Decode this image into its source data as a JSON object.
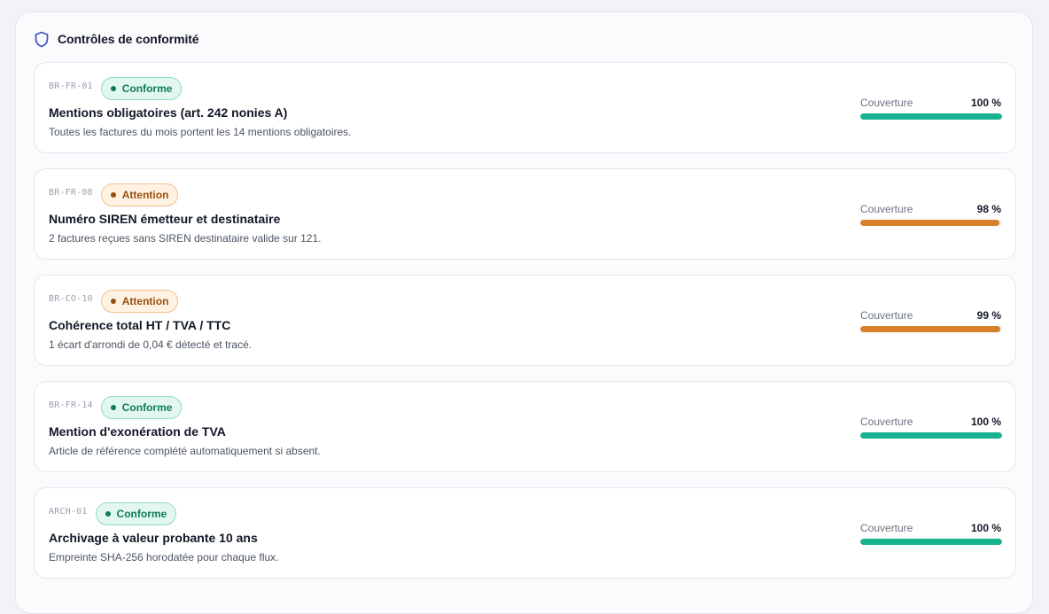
{
  "panel": {
    "title": "Contrôles de conformité",
    "icon": "shield-icon"
  },
  "colors": {
    "accent_ok": "#17b290",
    "accent_warn": "#d77f2b",
    "icon_blue": "#3b4fc8"
  },
  "checks": [
    {
      "code": "BR-FR-01",
      "status": "Conforme",
      "status_type": "ok",
      "title": "Mentions obligatoires (art. 242 nonies A)",
      "description": "Toutes les factures du mois portent les 14 mentions obligatoires.",
      "coverage_label": "Couverture",
      "coverage_text": "100 %",
      "coverage": 100
    },
    {
      "code": "BR-FR-08",
      "status": "Attention",
      "status_type": "warn",
      "title": "Numéro SIREN émetteur et destinataire",
      "description": "2 factures reçues sans SIREN destinataire valide sur 121.",
      "coverage_label": "Couverture",
      "coverage_text": "98 %",
      "coverage": 98
    },
    {
      "code": "BR-CO-10",
      "status": "Attention",
      "status_type": "warn",
      "title": "Cohérence total HT / TVA / TTC",
      "description": "1 écart d'arrondi de 0,04 € détecté et tracé.",
      "coverage_label": "Couverture",
      "coverage_text": "99 %",
      "coverage": 99
    },
    {
      "code": "BR-FR-14",
      "status": "Conforme",
      "status_type": "ok",
      "title": "Mention d'exonération de TVA",
      "description": "Article de référence complété automatiquement si absent.",
      "coverage_label": "Couverture",
      "coverage_text": "100 %",
      "coverage": 100
    },
    {
      "code": "ARCH-01",
      "status": "Conforme",
      "status_type": "ok",
      "title": "Archivage à valeur probante 10 ans",
      "description": "Empreinte SHA-256 horodatée pour chaque flux.",
      "coverage_label": "Couverture",
      "coverage_text": "100 %",
      "coverage": 100
    }
  ]
}
